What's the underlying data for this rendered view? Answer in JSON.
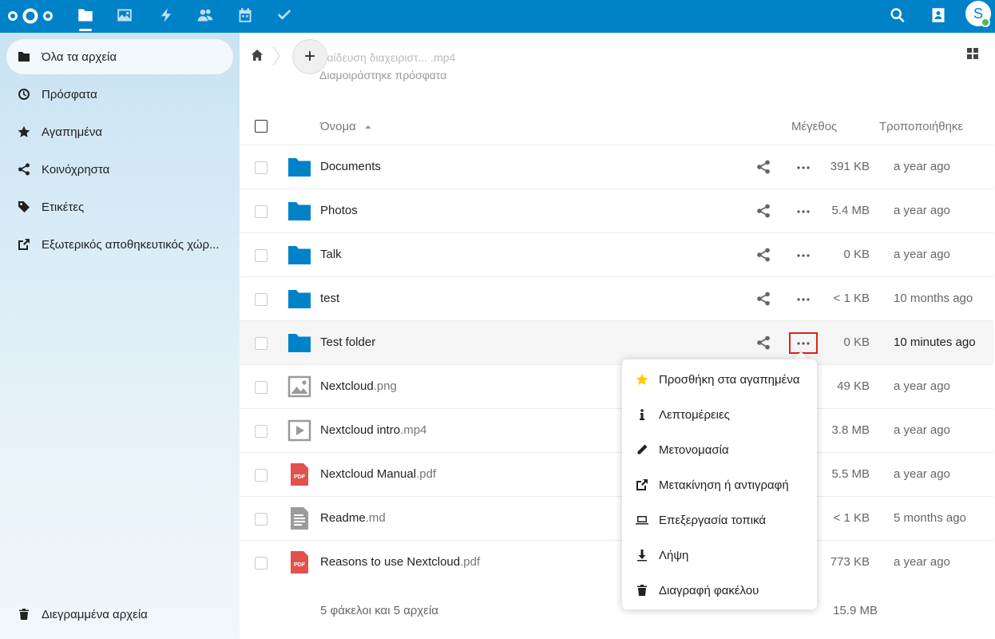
{
  "sidebar": {
    "items": [
      {
        "label": "Όλα τα αρχεία",
        "icon": "folder-icon"
      },
      {
        "label": "Πρόσφατα",
        "icon": "clock-icon"
      },
      {
        "label": "Αγαπημένα",
        "icon": "star-icon"
      },
      {
        "label": "Κοινόχρηστα",
        "icon": "share-icon"
      },
      {
        "label": "Ετικέτες",
        "icon": "tag-icon"
      },
      {
        "label": "Εξωτερικός αποθηκευτικός χώρ...",
        "icon": "external-link-icon"
      }
    ],
    "trash_label": "Διεγραμμένα αρχεία"
  },
  "header": {
    "avatar_initial": "S"
  },
  "main": {
    "ghost_line1": "παίδευση διαχειριστ... .mp4",
    "ghost_line2": "Διαμοιράστηκε πρόσφατα",
    "columns": {
      "name": "Όνομα",
      "size": "Μέγεθος",
      "modified": "Τροποποιήθηκε"
    },
    "files": [
      {
        "name": "Documents",
        "ext": "",
        "type": "folder",
        "size": "391 KB",
        "modified": "a year ago"
      },
      {
        "name": "Photos",
        "ext": "",
        "type": "folder",
        "size": "5.4 MB",
        "modified": "a year ago"
      },
      {
        "name": "Talk",
        "ext": "",
        "type": "folder",
        "size": "0 KB",
        "modified": "a year ago"
      },
      {
        "name": "test",
        "ext": "",
        "type": "folder",
        "size": "< 1 KB",
        "modified": "10 months ago"
      },
      {
        "name": "Test folder",
        "ext": "",
        "type": "folder",
        "size": "0 KB",
        "modified": "10 minutes ago"
      },
      {
        "name": "Nextcloud",
        "ext": ".png",
        "type": "image",
        "size": "49 KB",
        "modified": "a year ago"
      },
      {
        "name": "Nextcloud intro",
        "ext": ".mp4",
        "type": "video",
        "size": "3.8 MB",
        "modified": "a year ago"
      },
      {
        "name": "Nextcloud Manual",
        "ext": ".pdf",
        "type": "pdf",
        "size": "5.5 MB",
        "modified": "a year ago"
      },
      {
        "name": "Readme",
        "ext": ".md",
        "type": "text",
        "size": "< 1 KB",
        "modified": "5 months ago"
      },
      {
        "name": "Reasons to use Nextcloud",
        "ext": ".pdf",
        "type": "pdf",
        "size": "773 KB",
        "modified": "a year ago"
      }
    ],
    "summary": "5 φάκελοι και 5 αρχεία",
    "summary_size": "15.9 MB"
  },
  "pdf_badge": "PDF",
  "menu": {
    "items": [
      {
        "label": "Προσθήκη στα αγαπημένα",
        "icon": "star-icon"
      },
      {
        "label": "Λεπτομέρειες",
        "icon": "info-icon"
      },
      {
        "label": "Μετονομασία",
        "icon": "pencil-icon"
      },
      {
        "label": "Μετακίνηση ή αντιγραφή",
        "icon": "external-link-icon"
      },
      {
        "label": "Επεξεργασία τοπικά",
        "icon": "laptop-icon"
      },
      {
        "label": "Λήψη",
        "icon": "download-icon"
      },
      {
        "label": "Διαγραφή φακέλου",
        "icon": "trash-icon"
      }
    ]
  },
  "colors": {
    "brand": "#0082c9",
    "folder": "#0082c9",
    "pdf": "#e2514c",
    "favorite": "#fc0",
    "highlight_box": "#e02020"
  }
}
